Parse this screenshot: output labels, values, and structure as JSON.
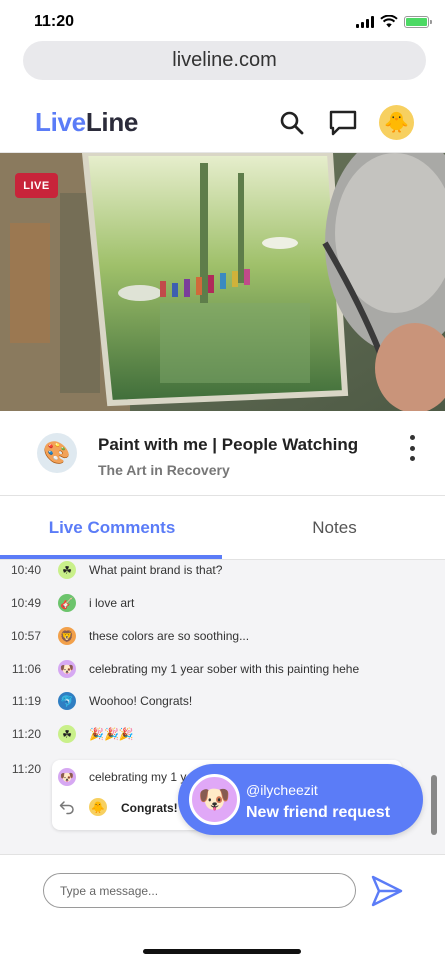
{
  "status_bar": {
    "time": "11:20"
  },
  "browser": {
    "url": "liveline.com"
  },
  "header": {
    "logo_part1": "Live",
    "logo_part2": "Line"
  },
  "video": {
    "live_label": "LIVE"
  },
  "stream": {
    "title": "Paint with me | People Watching",
    "channel": "The Art in Recovery"
  },
  "tabs": [
    {
      "label": "Live Comments",
      "active": true
    },
    {
      "label": "Notes",
      "active": false
    }
  ],
  "comments": [
    {
      "time": "10:40",
      "avatar": "clover-icon",
      "avatar_color": "#c9f08a",
      "text": "What paint brand is that?"
    },
    {
      "time": "10:49",
      "avatar": "guitar-icon",
      "avatar_color": "#6cc46c",
      "text": "i love art"
    },
    {
      "time": "10:57",
      "avatar": "lion-icon",
      "avatar_color": "#f2a04a",
      "text": "these colors are so soothing..."
    },
    {
      "time": "11:06",
      "avatar": "dog-icon",
      "avatar_color": "#d6a8f2",
      "text": "celebrating my 1 year sober with this painting hehe"
    },
    {
      "time": "11:19",
      "avatar": "dolphin-icon",
      "avatar_color": "#2f7ec2",
      "text": "Woohoo! Congrats!"
    },
    {
      "time": "11:20",
      "avatar": "clover-icon",
      "avatar_color": "#c9f08a",
      "text": "🎉🎉🎉"
    }
  ],
  "reply_thread": {
    "time": "11:20",
    "quoted_text": "celebrating my 1 y",
    "reply_text": "Congrats!"
  },
  "toast": {
    "username": "@ilycheezit",
    "message": "New friend request"
  },
  "composer": {
    "placeholder": "Type a message..."
  },
  "colors": {
    "accent": "#5b7cf7",
    "live": "#c8243a",
    "battery": "#4cd964"
  }
}
